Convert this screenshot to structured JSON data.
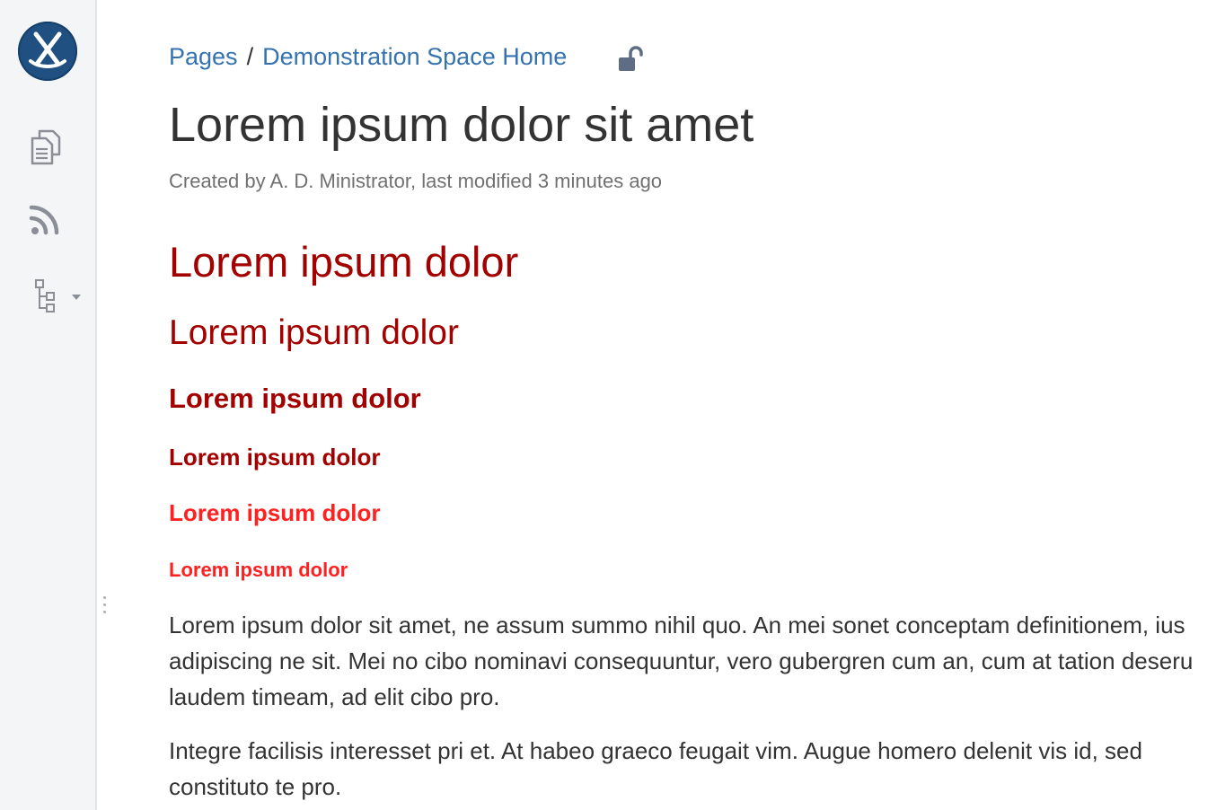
{
  "sidebar": {
    "logo_icon": "confluence-logo-icon",
    "items": [
      {
        "icon": "pages-icon"
      },
      {
        "icon": "rss-feed-icon"
      },
      {
        "icon": "page-tree-icon"
      }
    ],
    "bg_color": "#f4f5f7"
  },
  "breadcrumb": {
    "items": [
      "Pages",
      "Demonstration Space Home"
    ],
    "separator": "/",
    "restriction_icon": "unlocked-padlock-icon"
  },
  "page": {
    "title": "Lorem ipsum dolor sit amet",
    "byline": "Created by A. D. Ministrator, last modified 3 minutes ago"
  },
  "headings": [
    {
      "level": "h1",
      "text": "Lorem ipsum dolor",
      "color": "#a30000"
    },
    {
      "level": "h2",
      "text": "Lorem ipsum dolor",
      "color": "#a30000"
    },
    {
      "level": "h3",
      "text": "Lorem ipsum dolor",
      "color": "#a30000"
    },
    {
      "level": "h4",
      "text": "Lorem ipsum dolor",
      "color": "#a30000"
    },
    {
      "level": "h5",
      "text": "Lorem ipsum dolor",
      "color": "#ff2020"
    },
    {
      "level": "h6",
      "text": "Lorem ipsum dolor",
      "color": "#ff2020"
    }
  ],
  "paragraphs": [
    {
      "lines": [
        "Lorem ipsum dolor sit amet, ne assum summo nihil quo. An mei sonet conceptam definitionem, ius",
        "adipiscing ne sit. Mei no cibo nominavi consequuntur, vero gubergren cum an, cum at tation deseru",
        "laudem timeam, ad elit cibo pro."
      ]
    },
    {
      "lines": [
        "Integre facilisis interesset pri et. At habeo graeco feugait vim. Augue homero delenit vis id, sed",
        "constituto te pro."
      ]
    }
  ],
  "colors": {
    "link": "#3572b0",
    "text": "#333333",
    "meta": "#707070",
    "heading_dark_red": "#a30000",
    "heading_red": "#ff2020"
  }
}
